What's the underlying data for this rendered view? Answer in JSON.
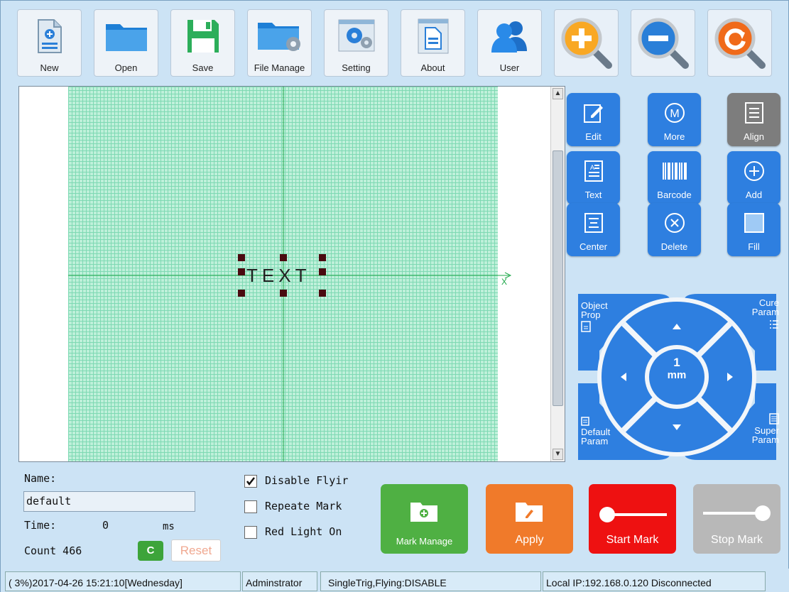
{
  "toolbar": {
    "new": "New",
    "open": "Open",
    "save": "Save",
    "file_manage": "File Manage",
    "setting": "Setting",
    "about": "About",
    "user": "User"
  },
  "canvas": {
    "text_object": "TEXT",
    "x_axis_label": "X"
  },
  "side_buttons": {
    "edit": "Edit",
    "more": "More",
    "align": "Align",
    "text": "Text",
    "barcode": "Barcode",
    "add": "Add",
    "center": "Center",
    "delete": "Delete",
    "fill": "Fill"
  },
  "dpad": {
    "object_prop": "Object\nProp",
    "cure_param": "Cure\nParam",
    "default_param": "Default\nParam",
    "super_param": "Super\nParam",
    "step_value": "1",
    "step_unit": "mm"
  },
  "form": {
    "name_label": "Name:",
    "name_value": "default",
    "time_label": "Time:",
    "time_value": "0",
    "time_unit": "ms",
    "count_label": "Count 466",
    "c_button": "C",
    "reset_button": "Reset"
  },
  "options": {
    "disable_flying": "Disable Flyir",
    "disable_flying_checked": true,
    "repeate_mark": "Repeate Mark",
    "red_light_on": "Red Light On"
  },
  "actions": {
    "mark_manage": "Mark Manage",
    "apply": "Apply",
    "start_mark": "Start Mark",
    "stop_mark": "Stop Mark"
  },
  "status": {
    "datetime": "( 3%)2017-04-26 15:21:10[Wednesday]",
    "user": "Adminstrator",
    "mode": "SingleTrig,Flying:DISABLE",
    "network": "Local IP:192.168.0.120 Disconnected"
  },
  "colors": {
    "accent_blue": "#2e7fe0",
    "mark_manage_green": "#4fb043",
    "apply_orange": "#f07a2a",
    "start_mark_red": "#ee1111",
    "stop_mark_gray": "#b8b8b8",
    "grid_green": "#bff0da"
  }
}
